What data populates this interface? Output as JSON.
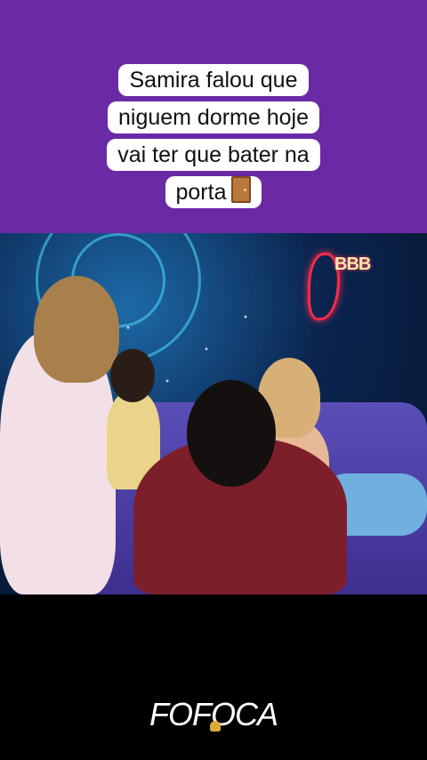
{
  "caption": {
    "lines": [
      "Samira falou que",
      "niguem dorme hoje",
      "vai ter que bater na",
      "porta"
    ],
    "emoji": "door-icon"
  },
  "video": {
    "channel_logo": "BBB"
  },
  "footer": {
    "label": "FOFOCA",
    "icon": "bell-icon"
  },
  "colors": {
    "top_background": "#6a2aa6",
    "caption_background": "#ffffff",
    "bottom_background": "#000000"
  }
}
